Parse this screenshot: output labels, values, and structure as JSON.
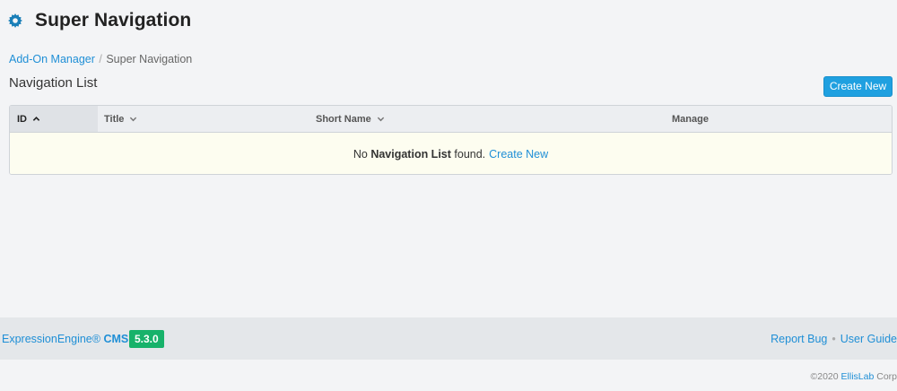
{
  "header": {
    "title": "Super Navigation",
    "icon": "gear-icon",
    "icon_color": "#1a7fb8"
  },
  "breadcrumb": {
    "parent": "Add-On Manager",
    "separator": "/",
    "current": "Super Navigation"
  },
  "section": {
    "title": "Navigation List",
    "create_button": "Create New"
  },
  "table": {
    "columns": [
      {
        "label": "ID",
        "sort": "chevron-up-icon"
      },
      {
        "label": "Title",
        "sort": "chevron-down-icon"
      },
      {
        "label": "Short Name",
        "sort": "chevron-down-icon"
      },
      {
        "label": "Manage"
      }
    ],
    "empty": {
      "prefix": "No",
      "entity": "Navigation List",
      "suffix": "found.",
      "link": "Create New"
    }
  },
  "footer": {
    "product": "ExpressionEngine®",
    "product_bold": "CMS",
    "version": "5.3.0",
    "report_bug": "Report Bug",
    "dot": "•",
    "user_guide": "User Guide",
    "copyright_prefix": "©2020",
    "company": "EllisLab",
    "copyright_suffix": "Corp"
  },
  "colors": {
    "accent": "#1fa0e0",
    "link": "#1f8fd6",
    "version_badge": "#17b26a"
  }
}
